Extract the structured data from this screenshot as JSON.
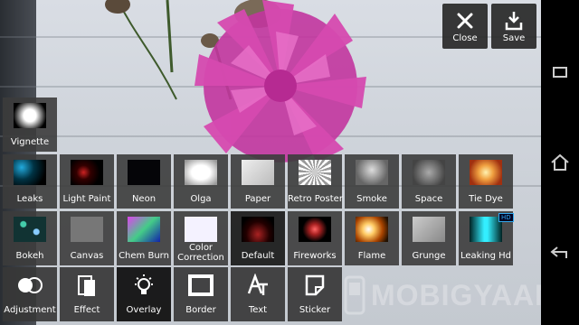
{
  "top_actions": {
    "close_label": "Close",
    "save_label": "Save"
  },
  "overlay_rows": [
    [
      {
        "label": "Vignette",
        "thumb": "vignette"
      }
    ],
    [
      {
        "label": "Leaks"
      },
      {
        "label": "Light Paint"
      },
      {
        "label": "Neon"
      },
      {
        "label": "Olga"
      },
      {
        "label": "Paper"
      },
      {
        "label": "Retro Poster"
      },
      {
        "label": "Smoke"
      },
      {
        "label": "Space"
      },
      {
        "label": "Tie Dye"
      }
    ],
    [
      {
        "label": "Bokeh"
      },
      {
        "label": "Canvas"
      },
      {
        "label": "Chem Burn"
      },
      {
        "label": "Color Correction"
      },
      {
        "label": "Default",
        "selected": true
      },
      {
        "label": "Fireworks"
      },
      {
        "label": "Flame"
      },
      {
        "label": "Grunge"
      },
      {
        "label": "Leaking Hd",
        "badge": "HD"
      }
    ]
  ],
  "tools": [
    {
      "label": "Adjustment",
      "icon": "adjustment-icon"
    },
    {
      "label": "Effect",
      "icon": "effect-icon"
    },
    {
      "label": "Overlay",
      "icon": "overlay-icon",
      "selected": true
    },
    {
      "label": "Border",
      "icon": "border-icon"
    },
    {
      "label": "Text",
      "icon": "text-icon"
    },
    {
      "label": "Sticker",
      "icon": "sticker-icon"
    }
  ],
  "watermark": "MOBIGYAAN",
  "nav": {
    "recent_icon": "recent-apps-icon",
    "home_icon": "home-icon",
    "back_icon": "back-icon"
  }
}
